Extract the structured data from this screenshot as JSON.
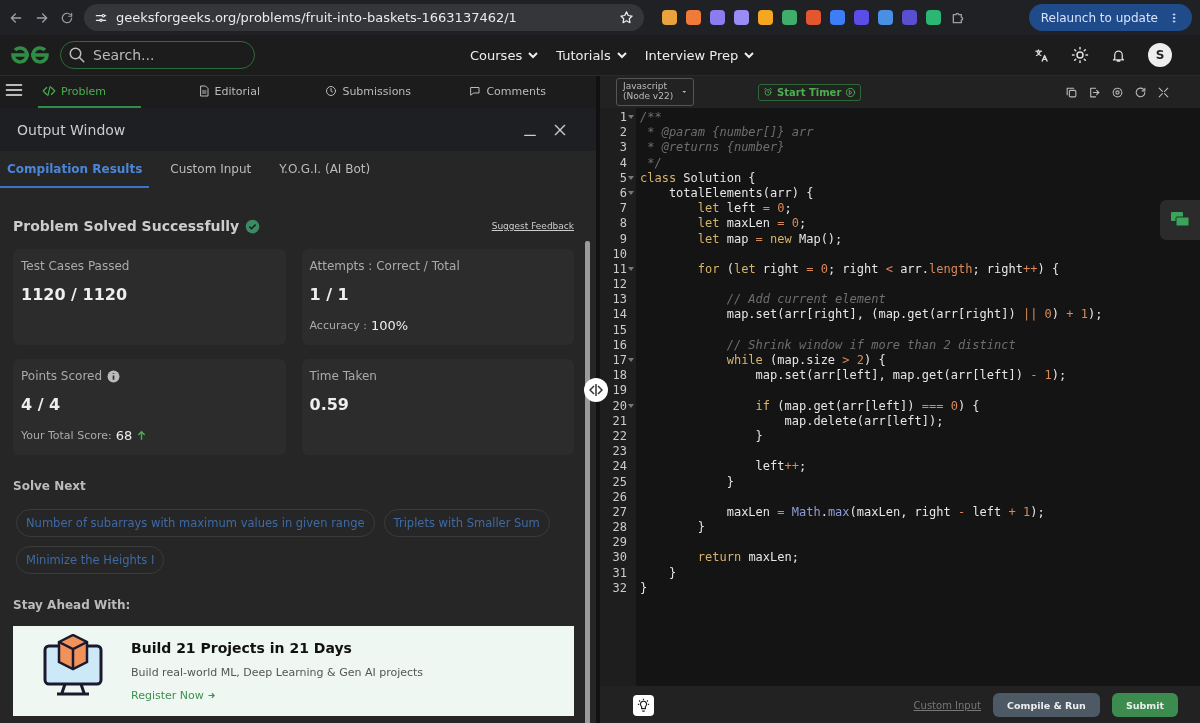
{
  "browser": {
    "url": "geeksforgeeks.org/problems/fruit-into-baskets-1663137462/1",
    "extensions": [
      {
        "color": "#e8a33c"
      },
      {
        "color": "#f07a3a"
      },
      {
        "color": "#8b7cf0"
      },
      {
        "color": "#9a8cf5"
      },
      {
        "color": "#f5a623"
      },
      {
        "color": "#3fae6a"
      },
      {
        "color": "#e2572f"
      },
      {
        "color": "#3d7df5"
      },
      {
        "color": "#5b4ee8"
      },
      {
        "color": "#4a90e2"
      },
      {
        "color": "#5a4fcf"
      },
      {
        "color": "#2bb673"
      }
    ],
    "relaunch": "Relaunch to update"
  },
  "nav": {
    "search": {
      "placeholder": "Search..."
    },
    "menus": [
      "Courses",
      "Tutorials",
      "Interview Prep"
    ],
    "avatar": "S"
  },
  "problem_tabs": [
    {
      "label": "Problem",
      "selected": true
    },
    {
      "label": "Editorial",
      "selected": false
    },
    {
      "label": "Submissions",
      "selected": false
    },
    {
      "label": "Comments",
      "selected": false
    }
  ],
  "output": {
    "title": "Output Window",
    "tabs": [
      {
        "label": "Compilation Results",
        "selected": true
      },
      {
        "label": "Custom Input",
        "selected": false
      },
      {
        "label": "Y.O.G.I. (AI Bot)",
        "selected": false
      }
    ],
    "status": "Problem Solved Successfully",
    "feedback": "Suggest Feedback",
    "cards": [
      {
        "label": "Test Cases Passed",
        "value": "1120 / 1120"
      },
      {
        "label": "Attempts : Correct / Total",
        "value": "1 / 1",
        "sub_label": "Accuracy :",
        "sub_value": "100%"
      },
      {
        "label": "Points Scored",
        "info": true,
        "value": "4 / 4",
        "sub_label": "Your Total Score:",
        "sub_value": "68",
        "trend_up": true
      },
      {
        "label": "Time Taken",
        "value": "0.59"
      }
    ],
    "solve_next_title": "Solve Next",
    "solve_next": [
      "Number of subarrays with maximum values in given range",
      "Triplets with Smaller Sum",
      "Minimize the Heights I"
    ],
    "stay_ahead_title": "Stay Ahead With:",
    "promo": {
      "title": "Build 21 Projects in 21 Days",
      "text": "Build real-world ML, Deep Learning & Gen AI projects",
      "link": "Register Now"
    }
  },
  "editor": {
    "language": "Javascript (Node v22)",
    "timer": "Start Timer",
    "lines": [
      {
        "number": "1",
        "fold": true,
        "tokens": [
          {
            "kind": "comment",
            "text": "/**"
          }
        ]
      },
      {
        "number": "2",
        "fold": false,
        "tokens": [
          {
            "kind": "comment",
            "text": " * @param {number[]} arr"
          }
        ]
      },
      {
        "number": "3",
        "fold": false,
        "tokens": [
          {
            "kind": "comment",
            "text": " * @returns {number}"
          }
        ]
      },
      {
        "number": "4",
        "fold": false,
        "tokens": [
          {
            "kind": "comment",
            "text": " */"
          }
        ]
      },
      {
        "number": "5",
        "fold": true,
        "tokens": [
          {
            "kind": "keyword",
            "text": "class"
          },
          {
            "kind": "plain",
            "text": " Solution {"
          }
        ]
      },
      {
        "number": "6",
        "fold": true,
        "tokens": [
          {
            "kind": "plain",
            "text": "    totalElements(arr) {"
          }
        ]
      },
      {
        "number": "7",
        "fold": false,
        "tokens": [
          {
            "kind": "keyword",
            "text": "        let"
          },
          {
            "kind": "plain",
            "text": " left "
          },
          {
            "kind": "operator",
            "text": "="
          },
          {
            "kind": "number",
            "text": " 0"
          },
          {
            "kind": "plain",
            "text": ";"
          }
        ]
      },
      {
        "number": "8",
        "fold": false,
        "tokens": [
          {
            "kind": "keyword",
            "text": "        let"
          },
          {
            "kind": "plain",
            "text": " maxLen "
          },
          {
            "kind": "operator",
            "text": "="
          },
          {
            "kind": "number",
            "text": " 0"
          },
          {
            "kind": "plain",
            "text": ";"
          }
        ]
      },
      {
        "number": "9",
        "fold": false,
        "tokens": [
          {
            "kind": "keyword",
            "text": "        let"
          },
          {
            "kind": "plain",
            "text": " map "
          },
          {
            "kind": "operator",
            "text": "="
          },
          {
            "kind": "keyword",
            "text": " new"
          },
          {
            "kind": "plain",
            "text": " Map();"
          }
        ]
      },
      {
        "number": "10",
        "fold": false
      },
      {
        "number": "11",
        "fold": true,
        "tokens": [
          {
            "kind": "keyword",
            "text": "        for"
          },
          {
            "kind": "plain",
            "text": " ("
          },
          {
            "kind": "keyword",
            "text": "let"
          },
          {
            "kind": "plain",
            "text": " right "
          },
          {
            "kind": "operator",
            "text": "="
          },
          {
            "kind": "number",
            "text": " 0"
          },
          {
            "kind": "plain",
            "text": "; right "
          },
          {
            "kind": "operator",
            "text": "<"
          },
          {
            "kind": "plain",
            "text": " arr."
          },
          {
            "kind": "number",
            "text": "length"
          },
          {
            "kind": "plain",
            "text": "; right"
          },
          {
            "kind": "operator",
            "text": "++"
          },
          {
            "kind": "plain",
            "text": ") {"
          }
        ]
      },
      {
        "number": "12",
        "fold": false
      },
      {
        "number": "13",
        "fold": false,
        "tokens": [
          {
            "kind": "comment",
            "text": "            // Add current element"
          }
        ]
      },
      {
        "number": "14",
        "fold": false,
        "tokens": [
          {
            "kind": "plain",
            "text": "            map.set(arr[right], (map.get(arr[right]) "
          },
          {
            "kind": "operator",
            "text": "||"
          },
          {
            "kind": "number",
            "text": " 0"
          },
          {
            "kind": "plain",
            "text": ") "
          },
          {
            "kind": "operator",
            "text": "+"
          },
          {
            "kind": "number",
            "text": " 1"
          },
          {
            "kind": "plain",
            "text": ");"
          }
        ]
      },
      {
        "number": "15",
        "fold": false
      },
      {
        "number": "16",
        "fold": false,
        "tokens": [
          {
            "kind": "comment",
            "text": "            // Shrink window if more than 2 distinct"
          }
        ]
      },
      {
        "number": "17",
        "fold": true,
        "tokens": [
          {
            "kind": "keyword",
            "text": "            while"
          },
          {
            "kind": "plain",
            "text": " (map.size "
          },
          {
            "kind": "operator",
            "text": ">"
          },
          {
            "kind": "number",
            "text": " 2"
          },
          {
            "kind": "plain",
            "text": ") {"
          }
        ]
      },
      {
        "number": "18",
        "fold": false,
        "tokens": [
          {
            "kind": "plain",
            "text": "                map.set(arr[left], map.get(arr[left]) "
          },
          {
            "kind": "operator",
            "text": "-"
          },
          {
            "kind": "number",
            "text": " 1"
          },
          {
            "kind": "plain",
            "text": ");"
          }
        ]
      },
      {
        "number": "19",
        "fold": false
      },
      {
        "number": "20",
        "fold": true,
        "tokens": [
          {
            "kind": "keyword",
            "text": "                if"
          },
          {
            "kind": "plain",
            "text": " (map.get(arr[left]) "
          },
          {
            "kind": "operator",
            "text": "==="
          },
          {
            "kind": "number",
            "text": " 0"
          },
          {
            "kind": "plain",
            "text": ") {"
          }
        ]
      },
      {
        "number": "21",
        "fold": false,
        "tokens": [
          {
            "kind": "plain",
            "text": "                    map.delete(arr[left]);"
          }
        ]
      },
      {
        "number": "22",
        "fold": false,
        "tokens": [
          {
            "kind": "plain",
            "text": "                }"
          }
        ]
      },
      {
        "number": "23",
        "fold": false
      },
      {
        "number": "24",
        "fold": false,
        "tokens": [
          {
            "kind": "plain",
            "text": "                left"
          },
          {
            "kind": "operator",
            "text": "++"
          },
          {
            "kind": "plain",
            "text": ";"
          }
        ]
      },
      {
        "number": "25",
        "fold": false,
        "tokens": [
          {
            "kind": "plain",
            "text": "            }"
          }
        ]
      },
      {
        "number": "26",
        "fold": false
      },
      {
        "number": "27",
        "fold": false,
        "tokens": [
          {
            "kind": "plain",
            "text": "            maxLen "
          },
          {
            "kind": "operator",
            "text": "="
          },
          {
            "kind": "builtin",
            "text": " Math"
          },
          {
            "kind": "plain",
            "text": "."
          },
          {
            "kind": "builtin",
            "text": "max"
          },
          {
            "kind": "plain",
            "text": "(maxLen, right "
          },
          {
            "kind": "operator",
            "text": "-"
          },
          {
            "kind": "plain",
            "text": " left "
          },
          {
            "kind": "operator",
            "text": "+"
          },
          {
            "kind": "number",
            "text": " 1"
          },
          {
            "kind": "plain",
            "text": ");"
          }
        ]
      },
      {
        "number": "28",
        "fold": false,
        "tokens": [
          {
            "kind": "plain",
            "text": "        }"
          }
        ]
      },
      {
        "number": "29",
        "fold": false
      },
      {
        "number": "30",
        "fold": false,
        "tokens": [
          {
            "kind": "keyword",
            "text": "        return"
          },
          {
            "kind": "plain",
            "text": " maxLen;"
          }
        ]
      },
      {
        "number": "31",
        "fold": false,
        "tokens": [
          {
            "kind": "plain",
            "text": "    }"
          }
        ]
      },
      {
        "number": "32",
        "fold": false,
        "tokens": [
          {
            "kind": "plain",
            "text": "}"
          }
        ]
      }
    ],
    "custom_input": "Custom Input",
    "compile": "Compile & Run",
    "submit": "Submit"
  }
}
